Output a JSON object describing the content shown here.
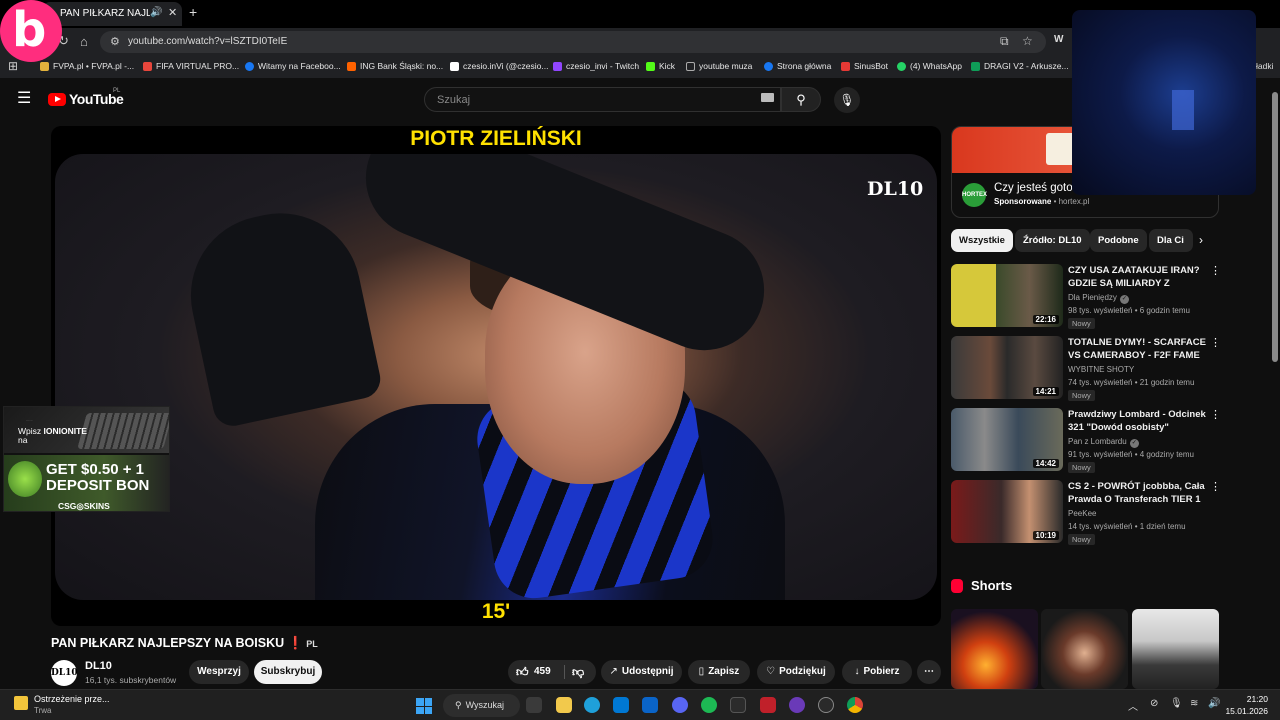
{
  "browser": {
    "tab_title": "PAN PIŁKARZ NAJLEPSZY",
    "tab_audio_icon": "speaker-icon",
    "url": "youtube.com/watch?v=lSZTDI0TeIE",
    "extension_label": "W",
    "bookmarks": [
      {
        "label": "FVPA.pl • FVPA.pl -...",
        "color": "#e3b23c"
      },
      {
        "label": "FIFA VIRTUAL PRO...",
        "color": "#e8463c"
      },
      {
        "label": "Witamy na Faceboo...",
        "color": "#1877f2"
      },
      {
        "label": "ING Bank Śląski: no...",
        "color": "#ff6200"
      },
      {
        "label": "czesio.inVi (@czesio...",
        "color": "#ffffff"
      },
      {
        "label": "czesio_invi - Twitch",
        "color": "#9146ff"
      },
      {
        "label": "Kick",
        "color": "#53fc18"
      },
      {
        "label": "youtube muza",
        "color": "#888888"
      },
      {
        "label": "Strona główna",
        "color": "#1877f2"
      },
      {
        "label": "SinusBot",
        "color": "#e53935"
      },
      {
        "label": "(4) WhatsApp",
        "color": "#25d366"
      },
      {
        "label": "DRAGI V2 - Arkusze...",
        "color": "#0f9d58"
      }
    ],
    "bookmarks_more": "ładki"
  },
  "youtube": {
    "logo_text": "YouTube",
    "country": "PL",
    "search_placeholder": "Szukaj"
  },
  "video": {
    "overlay_top": "PIOTR ZIELIŃSKI",
    "overlay_bottom": "15'",
    "watermark": "DL10",
    "title": "PAN PIŁKARZ NAJLEPSZY NA BOISKU",
    "title_mark": "❗",
    "title_lang": "PL",
    "channel_avatar_text": "DL10",
    "channel_name": "DL10",
    "channel_subs": "16,1 tys. subskrybentów",
    "support_label": "Wesprzyj",
    "subscribe_label": "Subskrybuj",
    "like_count": "459",
    "share_label": "Udostępnij",
    "save_label": "Zapisz",
    "thanks_label": "Podziękuj",
    "download_label": "Pobierz"
  },
  "ad_overlay": {
    "small_text": "......",
    "line1_prefix": "Wpisz",
    "line1_code": "IONIONITE",
    "line2": "na",
    "deal1": "GET $0.50 + 1",
    "deal2": "DEPOSIT BON",
    "brand": "CSG◎SKINS"
  },
  "sponsor": {
    "title": "Czy jesteś gotowy?",
    "label": "Sponsorowane",
    "domain": "hortex.pl",
    "logo_text": "HORTEX"
  },
  "chips": [
    "Wszystkie",
    "Źródło: DL10",
    "Podobne",
    "Dla Ci"
  ],
  "recommendations": [
    {
      "title": "CZY USA ZAATAKUJE IRAN? GDZIE SĄ MILIARDY Z S.A.F.E...",
      "channel": "Dla Pieniędzy",
      "verified": true,
      "views": "98 tys. wyświetleń",
      "age": "6 godzin temu",
      "badge": "Nowy",
      "duration": "22:16"
    },
    {
      "title": "TOTALNE DYMY! - SCARFACE VS CAMERABOY - F2F FAME 2...",
      "channel": "WYBITNE SHOTY",
      "verified": false,
      "views": "74 tys. wyświetleń",
      "age": "21 godzin temu",
      "badge": "Nowy",
      "duration": "14:21"
    },
    {
      "title": "Prawdziwy Lombard - Odcinek 321 \"Dowód osobisty\"",
      "channel": "Pan z Lombardu",
      "verified": true,
      "views": "91 tys. wyświetleń",
      "age": "4 godziny temu",
      "badge": "Nowy",
      "duration": "14:42"
    },
    {
      "title": "CS 2 - POWRÓT jcobbba, Cała Prawda O Transferach TIER 1 |...",
      "channel": "PeeKee",
      "verified": false,
      "views": "14 tys. wyświetleń",
      "age": "1 dzień temu",
      "badge": "Nowy",
      "duration": "10:19"
    }
  ],
  "shorts_label": "Shorts",
  "taskbar": {
    "warning_title": "Ostrzeżenie prze...",
    "warning_sub": "Trwa",
    "search_label": "Wyszukaj",
    "time": "21:20",
    "date": "15.01.2026"
  }
}
